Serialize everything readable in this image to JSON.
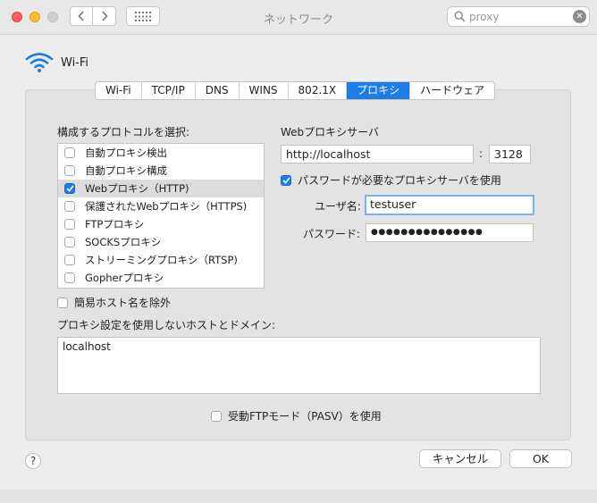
{
  "window": {
    "title": "ネットワーク",
    "search_value": "proxy"
  },
  "interface": {
    "name": "Wi-Fi"
  },
  "tabs": [
    {
      "label": "Wi-Fi"
    },
    {
      "label": "TCP/IP"
    },
    {
      "label": "DNS"
    },
    {
      "label": "WINS"
    },
    {
      "label": "802.1X"
    },
    {
      "label": "プロキシ",
      "active": true
    },
    {
      "label": "ハードウェア"
    }
  ],
  "protocols": {
    "heading": "構成するプロトコルを選択:",
    "items": [
      {
        "label": "自動プロキシ検出",
        "checked": false
      },
      {
        "label": "自動プロキシ構成",
        "checked": false
      },
      {
        "label": "Webプロキシ（HTTP)",
        "checked": true,
        "selected": true
      },
      {
        "label": "保護されたWebプロキシ（HTTPS)",
        "checked": false
      },
      {
        "label": "FTPプロキシ",
        "checked": false
      },
      {
        "label": "SOCKSプロキシ",
        "checked": false
      },
      {
        "label": "ストリーミングプロキシ（RTSP)",
        "checked": false
      },
      {
        "label": "Gopherプロキシ",
        "checked": false
      }
    ]
  },
  "server": {
    "heading": "Webプロキシサーバ",
    "host": "http://localhost",
    "separator": ":",
    "port": "3128",
    "password_required_label": "パスワードが必要なプロキシサーバを使用",
    "username_label": "ユーザ名:",
    "username": "testuser",
    "password_label": "パスワード:",
    "password": "●●●●●●●●●●●●●●●"
  },
  "exclude_simple_label": "簡易ホスト名を除外",
  "bypass": {
    "heading": "プロキシ設定を使用しないホストとドメイン:",
    "value": "localhost"
  },
  "pasv_label": "受動FTPモード（PASV）を使用",
  "buttons": {
    "help": "?",
    "cancel": "キャンセル",
    "ok": "OK"
  },
  "colors": {
    "accent": "#1c7ce8",
    "wifi": "#1c7ce8"
  }
}
